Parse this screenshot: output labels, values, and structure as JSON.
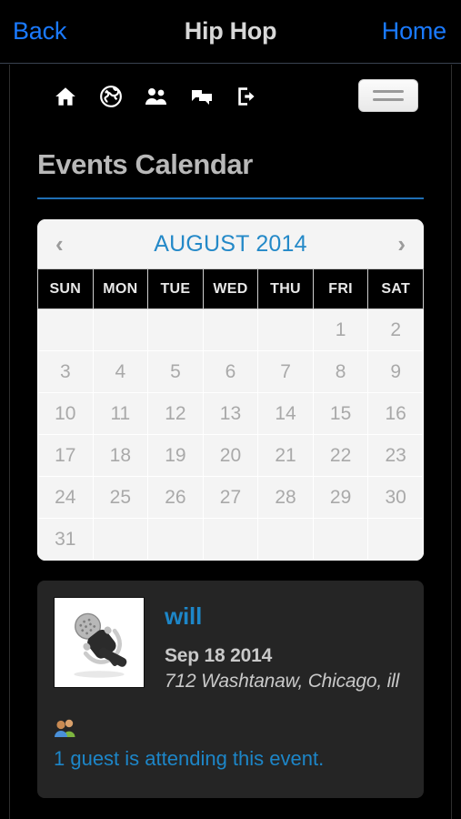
{
  "navbar": {
    "back_label": "Back",
    "title": "Hip Hop",
    "home_label": "Home"
  },
  "toolbar": {
    "icons": [
      {
        "name": "home-icon",
        "label": "Home"
      },
      {
        "name": "globe-icon",
        "label": "Explore"
      },
      {
        "name": "people-icon",
        "label": "Members"
      },
      {
        "name": "chat-icon",
        "label": "Messages"
      },
      {
        "name": "logout-icon",
        "label": "Sign Out"
      }
    ],
    "menu_button_label": "Menu"
  },
  "page": {
    "heading": "Events Calendar",
    "accent_color": "#1f6fb5",
    "link_color": "#1d86c8",
    "nav_link_color": "#1a7aff"
  },
  "calendar": {
    "month_label": "AUGUST 2014",
    "prev_label": "‹",
    "next_label": "›",
    "weekdays": [
      "SUN",
      "MON",
      "TUE",
      "WED",
      "THU",
      "FRI",
      "SAT"
    ],
    "weeks": [
      [
        "",
        "",
        "",
        "",
        "",
        "1",
        "2"
      ],
      [
        "3",
        "4",
        "5",
        "6",
        "7",
        "8",
        "9"
      ],
      [
        "10",
        "11",
        "12",
        "13",
        "14",
        "15",
        "16"
      ],
      [
        "17",
        "18",
        "19",
        "20",
        "21",
        "22",
        "23"
      ],
      [
        "24",
        "25",
        "26",
        "27",
        "28",
        "29",
        "30"
      ],
      [
        "31",
        "",
        "",
        "",
        "",
        "",
        ""
      ]
    ]
  },
  "event": {
    "thumbnail_name": "microphone-thumbnail",
    "title": "will",
    "date": "Sep 18 2014",
    "location": "712 Washtanaw, Chicago, ill",
    "guests_text": "1 guest is attending this event."
  }
}
